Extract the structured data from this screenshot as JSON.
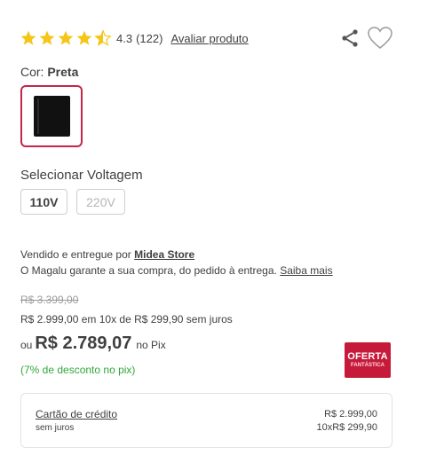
{
  "rating": {
    "value": "4.3",
    "count": "(122)",
    "rate_link": "Avaliar produto",
    "stars": 4.5,
    "star_color": "#f5c518"
  },
  "actions": {
    "share_icon": "share-icon",
    "favorite_icon": "heart-icon"
  },
  "color": {
    "label": "Cor:",
    "selected": "Preta",
    "selected_border": "#c4264b"
  },
  "voltage": {
    "label": "Selecionar Voltagem",
    "options": [
      "110V",
      "220V"
    ]
  },
  "seller": {
    "prefix": "Vendido e entregue por",
    "name": "Midea Store",
    "guarantee": "O Magalu garante a sua compra, do pedido à entrega.",
    "learn_more": "Saiba mais"
  },
  "price": {
    "old": "R$ 3.399,00",
    "installment": "R$ 2.999,00 em 10x de R$ 299,90 sem juros",
    "pix_prefix": "ou",
    "pix_price": "R$ 2.789,07",
    "pix_suffix": "no Pix",
    "discount": "(7% de desconto no pix)",
    "discount_color": "#2fa83a"
  },
  "badge": {
    "line1": "OFERTA",
    "line2": "FANTÁSTICA",
    "bg_color": "#c51a3a"
  },
  "payment": {
    "title": "Cartão de crédito",
    "subtitle": "sem juros",
    "amount": "R$ 2.999,00",
    "installments": "10xR$ 299,90"
  }
}
